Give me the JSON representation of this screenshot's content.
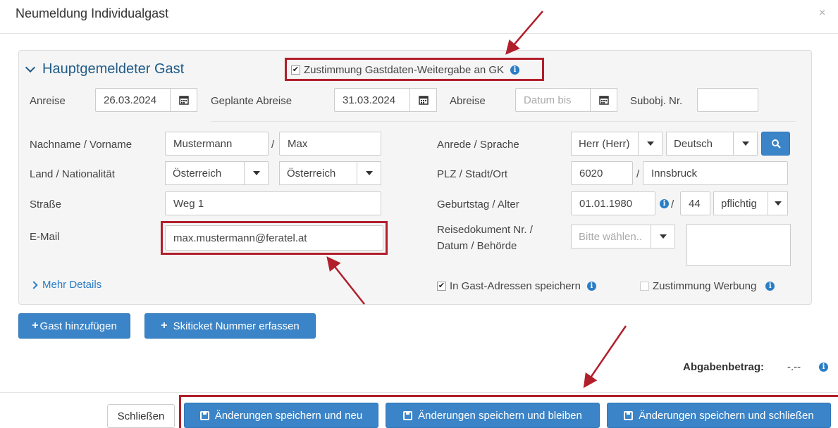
{
  "dialog": {
    "title": "Neumeldung Individualgast",
    "close_label": "×"
  },
  "section": {
    "title": "Hauptgemeldeter Gast",
    "consent_gk": {
      "label": "Zustimmung Gastdaten-Weitergabe an GK",
      "checked": true
    }
  },
  "dates": {
    "arrival_label": "Anreise",
    "arrival_value": "26.03.2024",
    "planned_departure_label": "Geplante Abreise",
    "planned_departure_value": "31.03.2024",
    "departure_label": "Abreise",
    "departure_placeholder": "Datum bis",
    "subobj_label": "Subobj. Nr.",
    "subobj_value": ""
  },
  "form": {
    "name_label": "Nachname / Vorname",
    "lastname": "Mustermann",
    "firstname": "Max",
    "slash": "/",
    "country_label": "Land / Nationalität",
    "country": "Österreich",
    "nationality": "Österreich",
    "street_label": "Straße",
    "street": "Weg 1",
    "email_label": "E-Mail",
    "email": "max.mustermann@feratel.at",
    "salutation_label": "Anrede / Sprache",
    "salutation": "Herr (Herr)",
    "language": "Deutsch",
    "zip_label": "PLZ / Stadt/Ort",
    "zip": "6020",
    "city": "Innsbruck",
    "birthday_label": "Geburtstag / Alter",
    "birthday": "01.01.1980",
    "age": "44",
    "obligation": "pflichtig",
    "travel_doc_label_1": "Reisedokument Nr. /",
    "travel_doc_label_2": "Datum / Behörde",
    "travel_doc_placeholder": "Bitte wählen..",
    "more_details": "Mehr Details",
    "save_address": {
      "label": "In Gast-Adressen speichern",
      "checked": true
    },
    "consent_ads": {
      "label": "Zustimmung Werbung",
      "checked": false
    }
  },
  "actions": {
    "add_guest": "Gast hinzufügen",
    "ski_ticket": "Skiticket Nummer erfassen",
    "fee_label": "Abgabenbetrag:",
    "fee_value": "-.--"
  },
  "footer": {
    "close": "Schließen",
    "save_new": "Änderungen speichern und neu",
    "save_stay": "Änderungen speichern und bleiben",
    "save_close": "Änderungen speichern und schließen"
  },
  "colors": {
    "accent": "#3b84c7",
    "highlight_red": "#b11f2b",
    "title_blue": "#1f5b87"
  }
}
